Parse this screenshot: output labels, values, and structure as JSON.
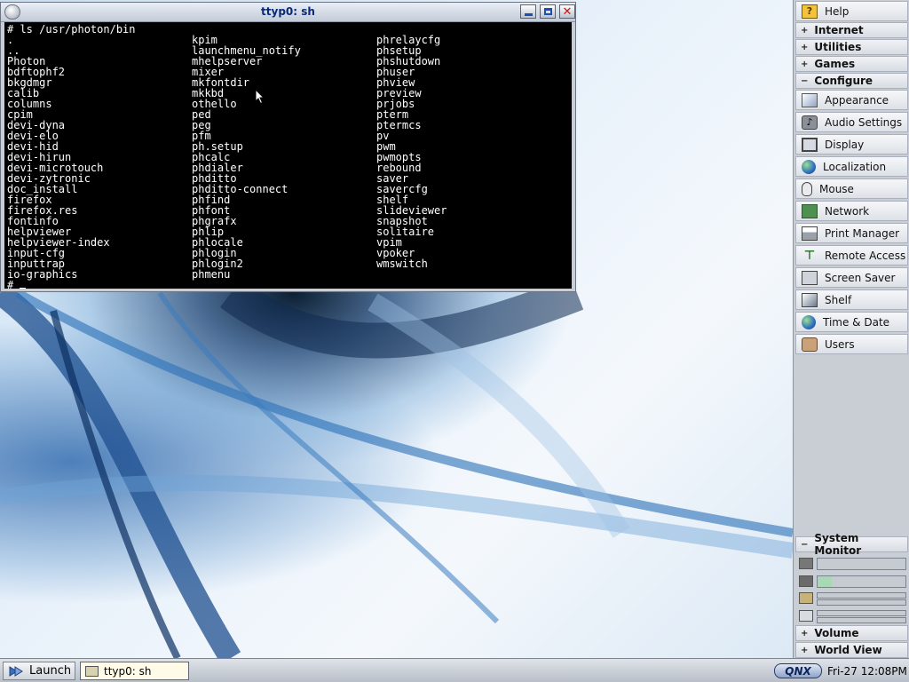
{
  "terminal": {
    "title": "ttyp0: sh",
    "command": "# ls /usr/photon/bin",
    "prompt": "#",
    "columns": [
      [
        ".",
        "..",
        "Photon",
        "bdftophf2",
        "bkgdmgr",
        "calib",
        "columns",
        "cpim",
        "devi-dyna",
        "devi-elo",
        "devi-hid",
        "devi-hirun",
        "devi-microtouch",
        "devi-zytronic",
        "doc_install",
        "firefox",
        "firefox.res",
        "fontinfo",
        "helpviewer",
        "helpviewer-index",
        "input-cfg",
        "inputtrap",
        "io-graphics"
      ],
      [
        "kpim",
        "launchmenu_notify",
        "mhelpserver",
        "mixer",
        "mkfontdir",
        "mkkbd",
        "othello",
        "ped",
        "peg",
        "pfm",
        "ph.setup",
        "phcalc",
        "phdialer",
        "phditto",
        "phditto-connect",
        "phfind",
        "phfont",
        "phgrafx",
        "phlip",
        "phlocale",
        "phlogin",
        "phlogin2",
        "phmenu"
      ],
      [
        "phrelaycfg",
        "phsetup",
        "phshutdown",
        "phuser",
        "phview",
        "preview",
        "prjobs",
        "pterm",
        "ptermcs",
        "pv",
        "pwm",
        "pwmopts",
        "rebound",
        "saver",
        "savercfg",
        "shelf",
        "slideviewer",
        "snapshot",
        "solitaire",
        "vpim",
        "vpoker",
        "wmswitch"
      ]
    ]
  },
  "shelf": {
    "help": "Help",
    "categories": {
      "internet": "Internet",
      "utilities": "Utilities",
      "games": "Games",
      "configure": "Configure"
    },
    "configure_items": [
      {
        "label": "Appearance",
        "icon": "appearance-icon"
      },
      {
        "label": "Audio Settings",
        "icon": "audio-icon"
      },
      {
        "label": "Display",
        "icon": "display-icon"
      },
      {
        "label": "Localization",
        "icon": "globe-icon"
      },
      {
        "label": "Mouse",
        "icon": "mouse-icon"
      },
      {
        "label": "Network",
        "icon": "network-icon"
      },
      {
        "label": "Print Manager",
        "icon": "printer-icon"
      },
      {
        "label": "Remote Access",
        "icon": "remote-icon"
      },
      {
        "label": "Screen Saver",
        "icon": "screensaver-icon"
      },
      {
        "label": "Shelf",
        "icon": "shelf-icon"
      },
      {
        "label": "Time & Date",
        "icon": "globe-icon"
      },
      {
        "label": "Users",
        "icon": "users-icon"
      }
    ],
    "system_monitor": {
      "title": "System Monitor",
      "cpu_load": 0.0,
      "memory_used": 0.16,
      "disk_used": 0.0,
      "network_used": 0.0
    },
    "volume": "Volume",
    "world_view": "World View"
  },
  "taskbar": {
    "launch": "Launch",
    "task_term": "ttyp0: sh",
    "logo": "QNX",
    "clock": "Fri-27 12:08PM"
  }
}
